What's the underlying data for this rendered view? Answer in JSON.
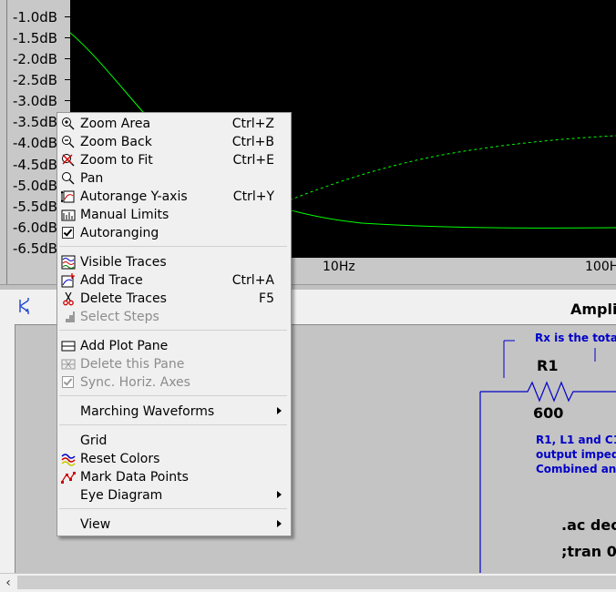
{
  "plot": {
    "y_ticks": [
      "-1.0dB",
      "-1.5dB",
      "-2.0dB",
      "-2.5dB",
      "-3.0dB",
      "-3.5dB",
      "-4.0dB",
      "-4.5dB",
      "-5.0dB",
      "-5.5dB",
      "-6.0dB",
      "-6.5dB"
    ],
    "x_ticks": [
      "10Hz",
      "100H"
    ],
    "trace_color": "#00ff00",
    "background": "#000000"
  },
  "schematic": {
    "title": "Ampli",
    "note_rx": "Rx is the total",
    "r1_label": "R1",
    "r1_value": "600",
    "note_lines": [
      "R1, L1 and C1",
      "output impeda",
      "Combined and"
    ],
    "directive_ac": ".ac dec",
    "directive_tran": ";tran 0"
  },
  "menu": {
    "items": [
      {
        "label": "Zoom Area",
        "shortcut": "Ctrl+Z",
        "icon": "zoom-in-icon"
      },
      {
        "label": "Zoom Back",
        "shortcut": "Ctrl+B",
        "icon": "zoom-out-icon"
      },
      {
        "label": "Zoom to Fit",
        "shortcut": "Ctrl+E",
        "icon": "zoom-fit-icon"
      },
      {
        "label": "Pan",
        "shortcut": "",
        "icon": "pan-icon"
      },
      {
        "label": "Autorange Y-axis",
        "shortcut": "Ctrl+Y",
        "icon": "autorange-icon"
      },
      {
        "label": "Manual Limits",
        "shortcut": "",
        "icon": "manual-limits-icon"
      },
      {
        "label": "Autoranging",
        "shortcut": "",
        "icon": "checkbox-icon"
      },
      {
        "label": "Visible Traces",
        "shortcut": "",
        "icon": "visible-traces-icon"
      },
      {
        "label": "Add Trace",
        "shortcut": "Ctrl+A",
        "icon": "add-trace-icon"
      },
      {
        "label": "Delete Traces",
        "shortcut": "F5",
        "icon": "scissors-icon"
      },
      {
        "label": "Select Steps",
        "shortcut": "",
        "icon": "steps-icon"
      },
      {
        "label": "Add Plot Pane",
        "shortcut": "",
        "icon": "add-pane-icon"
      },
      {
        "label": "Delete this Pane",
        "shortcut": "",
        "icon": "delete-pane-icon"
      },
      {
        "label": "Sync. Horiz. Axes",
        "shortcut": "",
        "icon": "checkbox-icon"
      },
      {
        "label": "Marching Waveforms",
        "shortcut": "",
        "icon": ""
      },
      {
        "label": "Grid",
        "shortcut": "",
        "icon": ""
      },
      {
        "label": "Reset Colors",
        "shortcut": "",
        "icon": "reset-colors-icon"
      },
      {
        "label": "Mark Data Points",
        "shortcut": "",
        "icon": "mark-points-icon"
      },
      {
        "label": "Eye Diagram",
        "shortcut": "",
        "icon": ""
      },
      {
        "label": "View",
        "shortcut": "",
        "icon": ""
      }
    ]
  }
}
